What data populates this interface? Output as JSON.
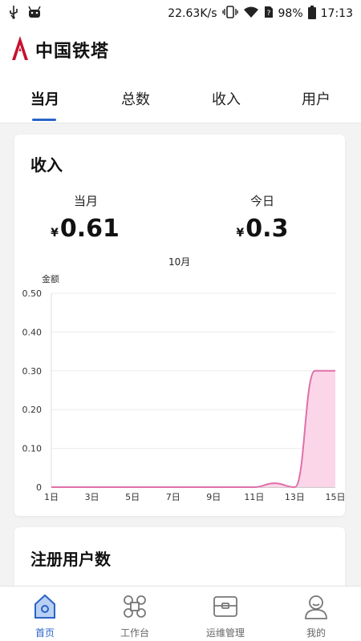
{
  "statusbar": {
    "speed": "22.63K/s",
    "battery": "98%",
    "time": "17:13"
  },
  "app": {
    "title": "中国铁塔"
  },
  "tabs": [
    {
      "label": "当月",
      "active": true
    },
    {
      "label": "总数",
      "active": false
    },
    {
      "label": "收入",
      "active": false
    },
    {
      "label": "用户",
      "active": false
    }
  ],
  "income_card": {
    "title": "收入",
    "month_label": "当月",
    "month_currency": "¥",
    "month_value": "0.61",
    "today_label": "今日",
    "today_currency": "¥",
    "today_value": "0.3"
  },
  "chart_data": {
    "type": "area",
    "title": "10月",
    "ylabel": "金额",
    "xlabel": "",
    "ylim": [
      0,
      0.5
    ],
    "y_ticks": [
      "0",
      "0.10",
      "0.20",
      "0.30",
      "0.40",
      "0.50"
    ],
    "x_ticks": [
      "1日",
      "3日",
      "5日",
      "7日",
      "9日",
      "11日",
      "13日",
      "15日"
    ],
    "x": [
      1,
      2,
      3,
      4,
      5,
      6,
      7,
      8,
      9,
      10,
      11,
      12,
      13,
      14,
      15
    ],
    "values": [
      0,
      0,
      0,
      0,
      0,
      0,
      0,
      0,
      0,
      0,
      0,
      0.01,
      0,
      0.3,
      0.3
    ],
    "color": "#e070a8",
    "fill_color": "#fbd6e8",
    "grid": true
  },
  "users_card": {
    "title": "注册用户数"
  },
  "bottom_nav": [
    {
      "label": "首页",
      "icon": "home-icon",
      "active": true
    },
    {
      "label": "工作台",
      "icon": "workbench-icon",
      "active": false
    },
    {
      "label": "运维管理",
      "icon": "operations-icon",
      "active": false
    },
    {
      "label": "我的",
      "icon": "profile-icon",
      "active": false
    }
  ],
  "colors": {
    "accent": "#2a63c8",
    "brand_red": "#c8102e"
  }
}
